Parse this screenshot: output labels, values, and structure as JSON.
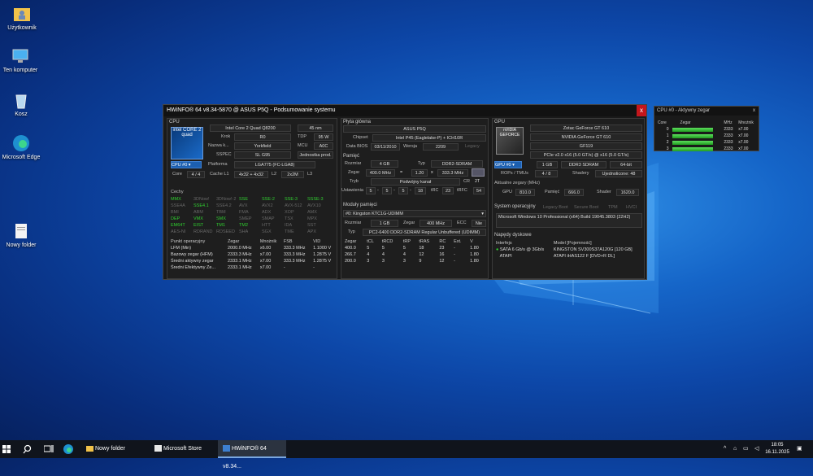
{
  "desktop": {
    "icons": [
      {
        "label": "Użytkownik"
      },
      {
        "label": "Ten komputer"
      },
      {
        "label": "Kosz"
      },
      {
        "label": "Microsoft Edge"
      },
      {
        "label": "Nowy folder"
      }
    ]
  },
  "window": {
    "title": "HWiNFO® 64 v8.34-5870 @ ASUS P5Q - Podsumowanie systemu",
    "close": "x"
  },
  "cpu": {
    "section": "CPU",
    "logo_text": "intel CORE 2 quad",
    "name": "Intel Core 2 Quad Q8200",
    "nm": "45 nm",
    "krok_label": "Krok",
    "krok": "R0",
    "tdp_label": "TDP",
    "tdp": "95 W",
    "nazwa_label": "Nazwa k...",
    "nazwa": "Yorkfield",
    "mcu_label": "MCU",
    "mcu": "A0C",
    "sspec_label": "SSPEC",
    "sspec": "SL G95",
    "unit": "Jednostka prod.",
    "selector": "CPU #0",
    "platforma_label": "Platforma",
    "platforma": "LGA775 (FC-LGA8)",
    "core_label": "Core",
    "core": "4 / 4",
    "cache_label": "Cache L1",
    "cache": "4x32 + 4x32",
    "l2_label": "L2",
    "l2": "2x2M",
    "l3_label": "L3",
    "l3": "",
    "cechy_label": "Cechy",
    "features": [
      [
        "MMX",
        "3DNow!",
        "3DNow!-2",
        "SSE",
        "SSE-2",
        "SSE-3",
        "SSSE-3"
      ],
      [
        "SSE4A",
        "SSE4.1",
        "SSE4.2",
        "AVX",
        "AVX2",
        "AVX-512",
        "AVX10"
      ],
      [
        "BMI",
        "ABM",
        "TBM",
        "FMA",
        "ADX",
        "XOP",
        "AMX"
      ],
      [
        "DEP",
        "VMX",
        "SMX",
        "SMEP",
        "SMAP",
        "TSX",
        "MPX"
      ],
      [
        "EM64T",
        "EIST",
        "TM1",
        "TM2",
        "HTT",
        "IDA",
        "SST"
      ],
      [
        "AES-NI",
        "RDRAND",
        "RDSEED",
        "SHA",
        "SGX",
        "TME",
        "APX"
      ]
    ],
    "feature_on": [
      [
        1,
        0,
        0,
        1,
        1,
        1,
        1
      ],
      [
        0,
        1,
        0,
        0,
        0,
        0,
        0
      ],
      [
        0,
        0,
        0,
        0,
        0,
        0,
        0
      ],
      [
        1,
        1,
        1,
        0,
        0,
        0,
        0
      ],
      [
        1,
        1,
        1,
        1,
        0,
        0,
        0
      ],
      [
        0,
        0,
        0,
        0,
        0,
        0,
        0
      ]
    ],
    "op_headers": [
      "Punkt operacyjny",
      "Zegar",
      "Mnożnik",
      "FSB",
      "VID"
    ],
    "op_rows": [
      [
        "LFM (Min)",
        "2000.0 MHz",
        "x6.00",
        "333.3 MHz",
        "1.1000 V"
      ],
      [
        "Bazowy zegar (HFM)",
        "2333.3 MHz",
        "x7.00",
        "333.3 MHz",
        "1.2875 V"
      ],
      [
        "Średni aktywny zegar",
        "2333.1 MHz",
        "x7.00",
        "333.3 MHz",
        "1.2875 V"
      ],
      [
        "Średni Efektywny Ze...",
        "2333.1 MHz",
        "x7.00",
        "-",
        "-"
      ]
    ]
  },
  "mobo": {
    "section": "Płyta główna",
    "name": "ASUS P5Q",
    "chipset_label": "Chipset",
    "chipset": "Intel P45 (Eaglelake-P) + ICH10R",
    "bios_label": "Data BIOS",
    "bios_date": "03/11/2010",
    "wersja_label": "Wersja",
    "wersja": "2209",
    "legacy": "Legacy"
  },
  "memory": {
    "section": "Pamięć",
    "rozmiar_label": "Rozmiar",
    "rozmiar": "4 GB",
    "typ_label": "Typ",
    "typ": "DDR2-SDRAM",
    "zegar_label": "Zegar",
    "zegar": "400.0 MHz",
    "eq": "=",
    "mult": "1.20",
    "x": "x",
    "fsb": "333.3 MHz",
    "tryb_label": "Tryb",
    "tryb": "Podwójny kanał",
    "cr_label": "CR",
    "cr": "2T",
    "timing_label": "Ustawienia",
    "timings": [
      "5",
      "5",
      "5",
      "18"
    ],
    "trc_label": "tRC",
    "trc": "23",
    "trfc_label": "tRFC",
    "trfc": "54",
    "modules_section": "Moduły pamięci",
    "module_select": "#0: Kingston KTC1G-UDIMM",
    "m_rozmiar": "1 GB",
    "m_zegar_label": "Zegar",
    "m_zegar": "400 MHz",
    "ecc_label": "ECC",
    "ecc": "Nie",
    "m_typ_label": "Typ",
    "m_typ": "PC2-6400 DDR2-SDRAM Regular Unbuffered (UDIMM)",
    "t_headers": [
      "Zegar",
      "tCL",
      "tRCD",
      "tRP",
      "tRAS",
      "RC",
      "Ext.",
      "V"
    ],
    "t_rows": [
      [
        "400.0",
        "5",
        "5",
        "5",
        "18",
        "23",
        "-",
        "1.80"
      ],
      [
        "266.7",
        "4",
        "4",
        "4",
        "12",
        "16",
        "-",
        "1.80"
      ],
      [
        "200.0",
        "3",
        "3",
        "3",
        "9",
        "12",
        "-",
        "1.80"
      ]
    ]
  },
  "gpu": {
    "section": "GPU",
    "logo_text": "nVIDIA GEFORCE",
    "vendor": "Zotac GeForce GT 610",
    "name": "NVIDIA GeForce GT 610",
    "code": "GF119",
    "pcie": "PCIe v2.0 x16 (5.0 GT/s) @ x16 (5.0 GT/s)",
    "selector": "GPU #0",
    "mem": "1 GB",
    "memtype": "DDR3 SDRAM",
    "bus": "64-bit",
    "rops_label": "ROPs / TMUs",
    "rops": "4 / 8",
    "shadery_label": "Shadery",
    "shadery": "Ujednolicone: 48",
    "clocks_label": "Aktualne zegary (MHz)",
    "gpu_label": "GPU",
    "gpu_clock": "810.0",
    "mem_label": "Pamięć",
    "mem_clock": "666.0",
    "shader_label": "Shader",
    "shader_clock": "1620.0"
  },
  "os": {
    "section": "System operacyjny",
    "flags": [
      "Legacy Boot",
      "Secure Boot",
      "TPM",
      "HVCI"
    ],
    "name": "Microsoft Windows 10 Professional (x64) Build 19045.3803 (22H2)"
  },
  "drives": {
    "section": "Napędy dyskowe",
    "headers": [
      "Interfejs",
      "Model [Pojemność]"
    ],
    "rows": [
      [
        "SATA 6 Gb/s @ 3Gb/s",
        "KINGSTON SV300S37A120G [120 GB]"
      ],
      [
        "ATAPI",
        "ATAPI iHAS122   F [DVD+R DL]"
      ]
    ]
  },
  "clock_window": {
    "title": "CPU #0 - Aktywny zegar",
    "close": "x",
    "headers": [
      "Core",
      "Zegar",
      "MHz",
      "Mnożnik"
    ],
    "rows": [
      [
        "0",
        "2333",
        "x7.00"
      ],
      [
        "1",
        "2333",
        "x7.00"
      ],
      [
        "2",
        "2333",
        "x7.00"
      ],
      [
        "3",
        "2333",
        "x7.00"
      ]
    ],
    "bar_fill": 1.0
  },
  "taskbar": {
    "items": [
      {
        "label": "Nowy folder"
      },
      {
        "label": "Microsoft Store"
      },
      {
        "label": "HWiNFO® 64 v8.34..."
      }
    ],
    "time": "18:05",
    "date": "16.11.2025"
  },
  "colors": {
    "accent": "#1c5fb0",
    "feature_on": "#30d030",
    "close": "#c4161c"
  }
}
